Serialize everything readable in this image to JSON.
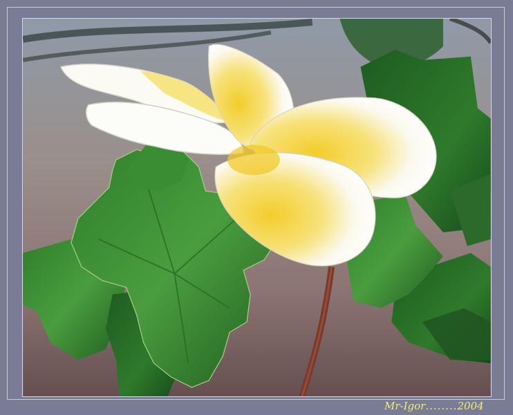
{
  "photo": {
    "subject": "plumeria-flower-with-green-leaves",
    "colors": {
      "frame": "#7a7c95",
      "frame_line": "#c9cbe0",
      "background_top": "#8b98a5",
      "background_mid": "#9b8782",
      "background_bottom": "#6e5a59",
      "petal_white": "#fbfbf6",
      "petal_yellow": "#f3d23a",
      "leaf_dark": "#1f6a24",
      "leaf_light": "#4aa33f",
      "stem": "#7a3a2a"
    }
  },
  "signature": {
    "author": "Mr-Igor",
    "separator": "........",
    "year": "2004",
    "color": "#f1f06b"
  }
}
